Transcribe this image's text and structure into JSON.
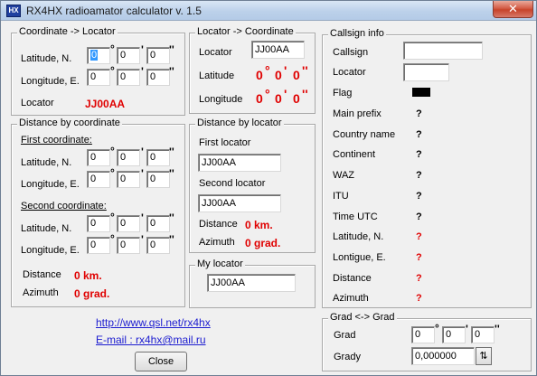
{
  "window": {
    "title": "RX4HX radioamator calculator v. 1.5",
    "app_icon_text": "HX",
    "close_glyph": "✕"
  },
  "symbols": {
    "deg": "°",
    "min": "'",
    "sec": "''"
  },
  "coord_to_locator": {
    "title": "Coordinate -> Locator",
    "latitude_label": "Latitude, N.",
    "longitude_label": "Longitude, E.",
    "latitude": [
      "0",
      "0",
      "0"
    ],
    "longitude": [
      "0",
      "0",
      "0"
    ],
    "locator_label": "Locator",
    "locator_value": "JJ00AA"
  },
  "locator_to_coord": {
    "title": "Locator -> Coordinate",
    "locator_label": "Locator",
    "locator_input": "JJ00AA",
    "latitude_label": "Latitude",
    "longitude_label": "Longitude",
    "latitude": [
      "0",
      "0",
      "0"
    ],
    "longitude": [
      "0",
      "0",
      "0"
    ]
  },
  "distance_by_coordinate": {
    "title": "Distance by coordinate",
    "first_label": "First coordinate:",
    "second_label": "Second coordinate:",
    "latitude_label": "Latitude, N.",
    "longitude_label": "Longitude, E.",
    "first_lat": [
      "0",
      "0",
      "0"
    ],
    "first_lon": [
      "0",
      "0",
      "0"
    ],
    "second_lat": [
      "0",
      "0",
      "0"
    ],
    "second_lon": [
      "0",
      "0",
      "0"
    ],
    "distance_label": "Distance",
    "distance_value": "0 km.",
    "azimuth_label": "Azimuth",
    "azimuth_value": "0 grad."
  },
  "distance_by_locator": {
    "title": "Distance by locator",
    "first_label": "First  locator",
    "first_value": "JJ00AA",
    "second_label": "Second locator",
    "second_value": "JJ00AA",
    "distance_label": "Distance",
    "distance_value": "0 km.",
    "azimuth_label": "Azimuth",
    "azimuth_value": "0 grad."
  },
  "my_locator": {
    "title": "My locator",
    "value": "JJ00AA"
  },
  "callsign_info": {
    "title": "Callsign info",
    "callsign_label": "Callsign",
    "callsign_value": "",
    "locator_label": "Locator",
    "locator_value": "",
    "flag_label": "Flag",
    "rows": [
      {
        "label": "Main prefix",
        "value": "?"
      },
      {
        "label": "Country name",
        "value": "?"
      },
      {
        "label": "Continent",
        "value": "?"
      },
      {
        "label": "WAZ",
        "value": "?"
      },
      {
        "label": "ITU",
        "value": "?"
      },
      {
        "label": "Time UTC",
        "value": "?"
      },
      {
        "label": "Latitude, N.",
        "value": "?"
      },
      {
        "label": "Lontigue, E.",
        "value": "?"
      },
      {
        "label": "Distance",
        "value": "?"
      },
      {
        "label": "Azimuth",
        "value": "?"
      }
    ]
  },
  "grad_conv": {
    "title": "Grad <-> Grad",
    "grad_label": "Grad",
    "grad": [
      "0",
      "0",
      "0"
    ],
    "grady_label": "Grady",
    "grady_value": "0,000000",
    "spin_glyph": "⇅"
  },
  "links": {
    "website": "http://www.qsl.net/rx4hx",
    "email": "E-mail : rx4hx@mail.ru"
  },
  "close_button": "Close"
}
